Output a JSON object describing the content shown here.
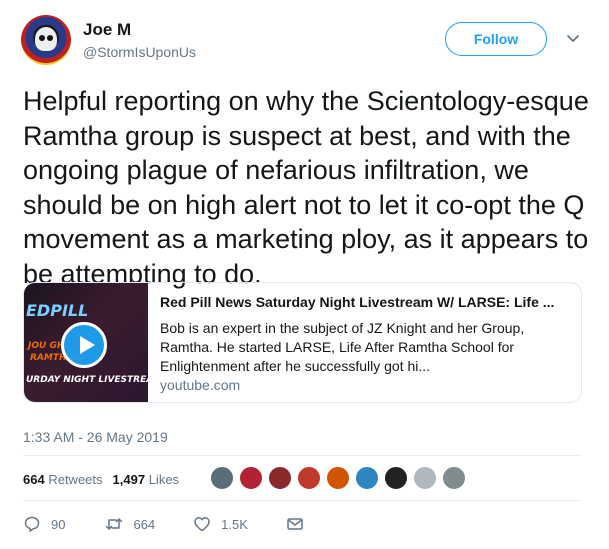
{
  "author": {
    "display_name": "Joe M",
    "handle": "@StormIsUponUs"
  },
  "header": {
    "follow_label": "Follow"
  },
  "tweet": {
    "text": "Helpful reporting on why the Scientology-esque Ramtha group is suspect at best, and with the ongoing plague of nefarious infiltration, we should be on high alert not to let it co-opt the Q movement as a marketing ploy, as it appears to be attempting to do.",
    "timestamp": "1:33 AM - 26 May 2019"
  },
  "card": {
    "title": "Red Pill News Saturday Night Livestream W/ LARSE: Life ...",
    "description": "Bob is an expert in the subject of JZ Knight and her Group, Ramtha. He started LARSE, Life After Ramtha School for Enlightenment after he successfully got hi...",
    "domain": "youtube.com",
    "thumbnail_text": {
      "line1": "EDPILL",
      "line2": "JOU    GH",
      "line3": "RAMTH  ND",
      "line4": "URDAY NIGHT LIVESTREAM"
    }
  },
  "stats": {
    "retweets_count": "664",
    "retweets_label": "Retweets",
    "likes_count": "1,497",
    "likes_label": "Likes"
  },
  "liker_colors": [
    "#5a6e7a",
    "#b22234",
    "#8a2a2a",
    "#c0392b",
    "#d35400",
    "#2e86c1",
    "#222222",
    "#b0b8bf",
    "#7f8c8d"
  ],
  "actions": {
    "replies": "90",
    "retweets": "664",
    "likes": "1.5K"
  },
  "colors": {
    "accent": "#1da1f2",
    "muted": "#657786",
    "text": "#14171a"
  }
}
